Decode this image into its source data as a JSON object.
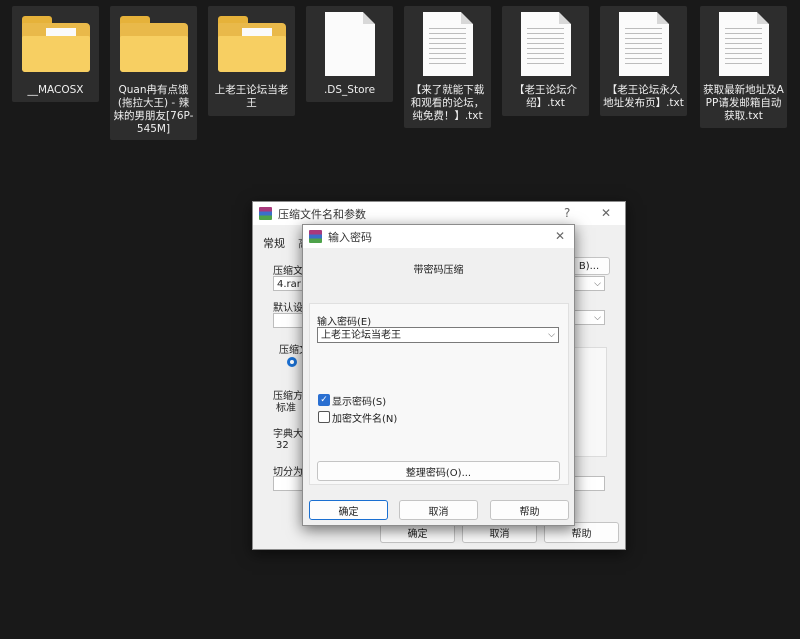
{
  "desktop": {
    "files": [
      {
        "name": "__MACOSX",
        "icon": "folder-icon"
      },
      {
        "name": "Quan冉有点饿(拖拉大王) - 辣妹的男朋友[76P-545M]",
        "icon": "folder-icon"
      },
      {
        "name": "上老王论坛当老王",
        "icon": "folder-icon"
      },
      {
        "name": ".DS_Store",
        "icon": "blank-file-icon"
      },
      {
        "name": "【来了就能下载和观看的论坛，纯免费！】.txt",
        "icon": "text-file-icon"
      },
      {
        "name": "【老王论坛介绍】.txt",
        "icon": "text-file-icon"
      },
      {
        "name": "【老王论坛永久地址发布页】.txt",
        "icon": "text-file-icon"
      },
      {
        "name": "获取最新地址及APP请发邮箱自动获取.txt",
        "icon": "text-file-icon"
      }
    ]
  },
  "archive_dialog": {
    "title": "压缩文件名和参数",
    "help_glyph": "?",
    "close_glyph": "✕",
    "tab_general": "常规",
    "tab_advanced_partial": "高",
    "filename_label": "压缩文件",
    "filename_value": "4.rar",
    "browse_label": "B)...",
    "profile_label": "默认设置",
    "format_label": "压缩文",
    "method_label": "压缩方",
    "method_value": "标准",
    "dict_label": "字典大小",
    "dict_value": "32",
    "split_label": "切分为分卷",
    "ok": "确定",
    "cancel": "取消",
    "help": "帮助"
  },
  "password_dialog": {
    "title": "输入密码",
    "close_glyph": "✕",
    "subtitle": "带密码压缩",
    "password_label": "输入密码(E)",
    "password_value": "上老王论坛当老王",
    "show_password_label": "显示密码(S)",
    "show_password_checked": true,
    "encrypt_names_label": "加密文件名(N)",
    "encrypt_names_checked": false,
    "organize_button": "整理密码(O)...",
    "ok": "确定",
    "cancel": "取消",
    "help": "帮助"
  }
}
